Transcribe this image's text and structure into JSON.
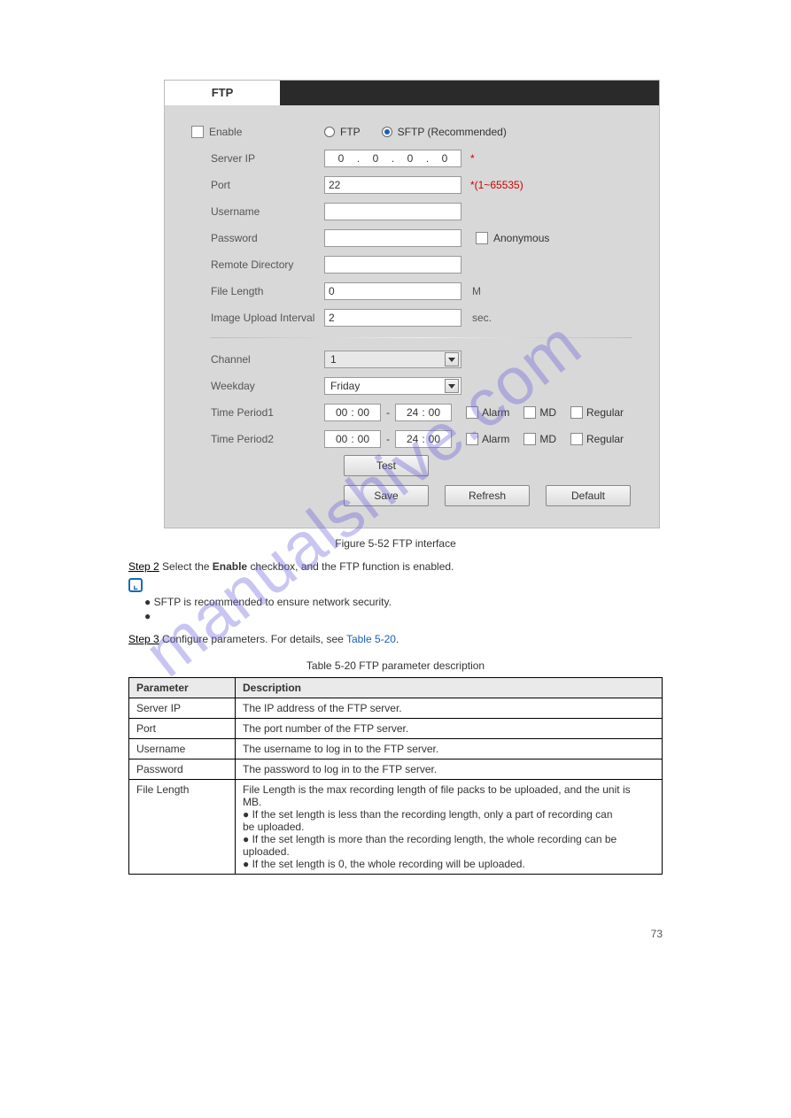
{
  "watermark": "manualshive.com",
  "tabs": {
    "ftp": "FTP"
  },
  "form": {
    "enable_label": "Enable",
    "protocol": {
      "ftp_label": "FTP",
      "sftp_label": "SFTP (Recommended)"
    },
    "server_ip": {
      "label": "Server IP",
      "a": "0",
      "b": "0",
      "c": "0",
      "d": "0",
      "asterisk": "*"
    },
    "port": {
      "label": "Port",
      "value": "22",
      "hint": "*(1~65535)"
    },
    "username": {
      "label": "Username",
      "value": ""
    },
    "password": {
      "label": "Password",
      "value": "",
      "anon_label": "Anonymous"
    },
    "remote_dir": {
      "label": "Remote Directory",
      "value": ""
    },
    "file_length": {
      "label": "File Length",
      "value": "0",
      "unit": "M"
    },
    "upload_interval": {
      "label": "Image Upload Interval",
      "value": "2",
      "unit": "sec."
    },
    "channel": {
      "label": "Channel",
      "value": "1"
    },
    "weekday": {
      "label": "Weekday",
      "value": "Friday"
    },
    "tp1": {
      "label": "Time Period1",
      "h1": "00",
      "m1": "00",
      "h2": "24",
      "m2": "00",
      "alarm": "Alarm",
      "md": "MD",
      "regular": "Regular"
    },
    "tp2": {
      "label": "Time Period2",
      "h1": "00",
      "m1": "00",
      "h2": "24",
      "m2": "00",
      "alarm": "Alarm",
      "md": "MD",
      "regular": "Regular"
    },
    "buttons": {
      "test": "Test",
      "save": "Save",
      "refresh": "Refresh",
      "default": "Default"
    }
  },
  "caption": "Figure 5-52 FTP interface",
  "step2_label": "Step 2",
  "step2_text": "Select the ",
  "step2_bold": "Enable",
  "step2_rest": " checkbox, and the FTP function is enabled.",
  "note_bullets": [
    "SFTP is recommended to ensure network security.",
    ""
  ],
  "step3_label": "Step 3",
  "step3_text": "Configure parameters. For details, see ",
  "step3_link": "Table 5-20",
  "table_title": "Table 5-20 FTP parameter description",
  "table": {
    "head_param": "Parameter",
    "head_desc": "Description",
    "rows": [
      {
        "p": "Server IP",
        "d": "The IP address of the FTP server."
      },
      {
        "p": "Port",
        "d": "The port number of the FTP server."
      },
      {
        "p": "Username",
        "d": "The username to log in to the FTP server."
      },
      {
        "p": "Password",
        "d": "The password to log in to the FTP server."
      },
      {
        "p": "File Length",
        "d_lines": [
          "File Length is the max recording length of file packs to be uploaded, and the unit is",
          "MB.",
          "●   If the set length is less than the recording length, only a part of recording can",
          "    be uploaded.",
          "●   If the set length is more than the recording length, the whole recording can be",
          "    uploaded.",
          "●   If the set length is 0, the whole recording will be uploaded."
        ]
      }
    ]
  },
  "footer": "73"
}
